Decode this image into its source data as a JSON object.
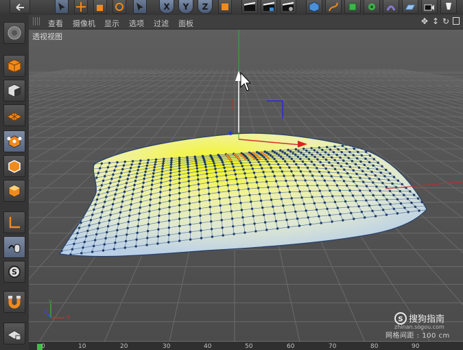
{
  "menubar": {
    "items": [
      "查看",
      "摄像机",
      "显示",
      "选项",
      "过滤",
      "面板"
    ]
  },
  "viewport": {
    "label": "透视视图",
    "grid_spacing": "网格间距 : 100 cm",
    "axis_y": "Y",
    "axis_x": "X",
    "axis_z": "Z"
  },
  "toolbar": {
    "axis_x": "X",
    "axis_y": "Y",
    "axis_z": "Z"
  },
  "watermark": {
    "brand": "搜狗指南",
    "url": "zhinan.sogou.com"
  },
  "timeline": {
    "ticks": [
      "0",
      "10",
      "20",
      "30",
      "40",
      "50",
      "60",
      "70",
      "80",
      "90"
    ]
  },
  "colors": {
    "accent_orange": "#f08a1c",
    "accent_blue": "#7a8ca8",
    "mesh_vertex": "#1f3a66",
    "surface_highlight": "#f2f21a"
  }
}
